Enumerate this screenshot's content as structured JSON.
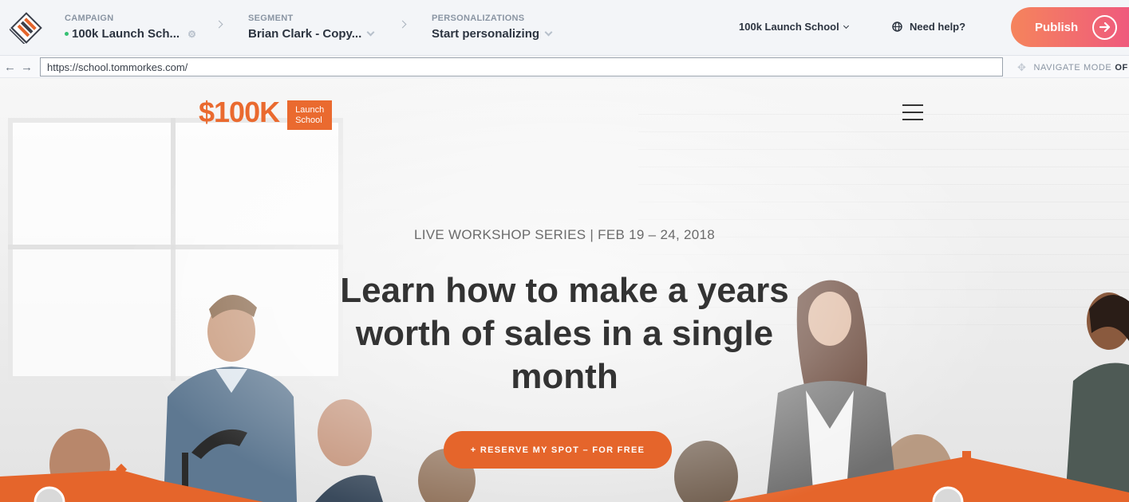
{
  "editor": {
    "campaign": {
      "label": "CAMPAIGN",
      "value": "100k Launch Sch..."
    },
    "segment": {
      "label": "SEGMENT",
      "value": "Brian Clark - Copy..."
    },
    "personalizations": {
      "label": "PERSONALIZATIONS",
      "value": "Start personalizing"
    },
    "site_selector": "100k Launch School",
    "help": "Need help?",
    "publish": "Publish"
  },
  "urlbar": {
    "url": "https://school.tommorkes.com/",
    "navigate_mode_label": "NAVIGATE MODE",
    "navigate_mode_value": "OF"
  },
  "site": {
    "logo_text": "$100K",
    "logo_box_line1": "Launch",
    "logo_box_line2": "School",
    "subheading": "LIVE WORKSHOP SERIES | FEB 19 – 24, 2018",
    "headline": "Learn how to make a years worth of sales in a single month",
    "cta": "+ RESERVE MY SPOT – FOR FREE"
  },
  "colors": {
    "brand_orange": "#ea6a2f",
    "publish_gradient_start": "#f5845c",
    "publish_gradient_end": "#ef5a7d",
    "status_green": "#35c073"
  },
  "icons": [
    "app-logo-icon",
    "status-dot-icon",
    "gear-icon",
    "chevron-down-icon",
    "chevron-right-icon",
    "globe-help-icon",
    "arrow-right-icon",
    "back-arrow-icon",
    "forward-arrow-icon",
    "navigate-mode-icon",
    "hamburger-menu-icon"
  ]
}
